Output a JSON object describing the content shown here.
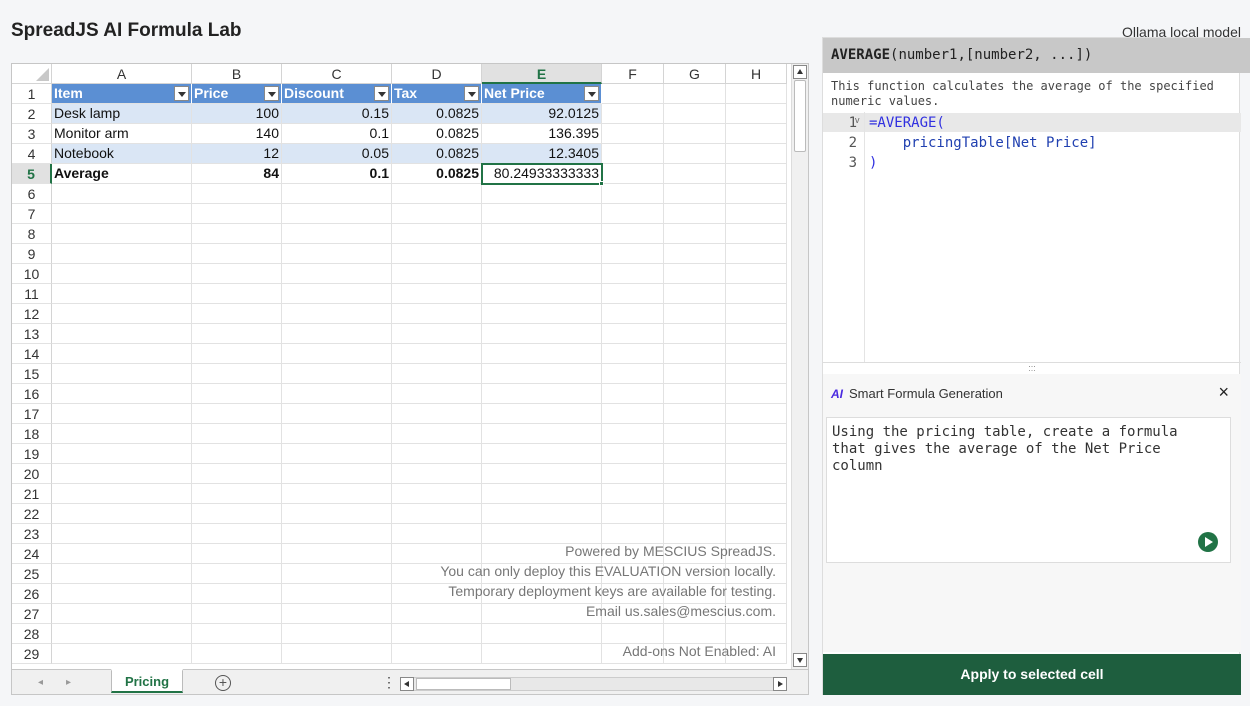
{
  "app": {
    "title": "SpreadJS AI Formula Lab",
    "model_label": "Ollama local model"
  },
  "sheet": {
    "columns": [
      "A",
      "B",
      "C",
      "D",
      "E",
      "F",
      "G",
      "H"
    ],
    "active_column": "E",
    "active_row": 5,
    "row_count": 29,
    "table_headers": [
      "Item",
      "Price",
      "Discount",
      "Tax",
      "Net Price"
    ],
    "rows": [
      [
        "Desk lamp",
        "100",
        "0.15",
        "0.0825",
        "92.0125"
      ],
      [
        "Monitor arm",
        "140",
        "0.1",
        "0.0825",
        "136.395"
      ],
      [
        "Notebook",
        "12",
        "0.05",
        "0.0825",
        "12.3405"
      ],
      [
        "Average",
        "84",
        "0.1",
        "0.0825",
        "80.24933333333"
      ]
    ],
    "colors": {
      "header": "#5b8fd3",
      "band": "#dae6f5",
      "accent": "#217346"
    },
    "watermark_lines": [
      "Powered by MESCIUS SpreadJS.",
      "You can only deploy this EVALUATION version locally.",
      "Temporary deployment keys are available for testing.",
      "Email us.sales@mescius.com.",
      "",
      "Add-ons Not Enabled: AI"
    ],
    "tab_name": "Pricing",
    "add_sheet_label": "+",
    "tab_menu_label": "⋮"
  },
  "panel": {
    "signature_name": "AVERAGE",
    "signature_args": "(number1,[number2, ...])",
    "description": "This function calculates the average of the specified numeric values.",
    "code": {
      "line1": "=AVERAGE(",
      "line2": "    pricingTable[Net Price]",
      "line3": ")"
    },
    "help_label": "?",
    "splitter_label": ":::",
    "smart_title": "Smart Formula Generation",
    "ai_badge": "AI",
    "close_label": "×",
    "prompt": "Using the pricing table, create a formula that gives the average of the Net Price column",
    "apply_label": "Apply to selected cell"
  }
}
